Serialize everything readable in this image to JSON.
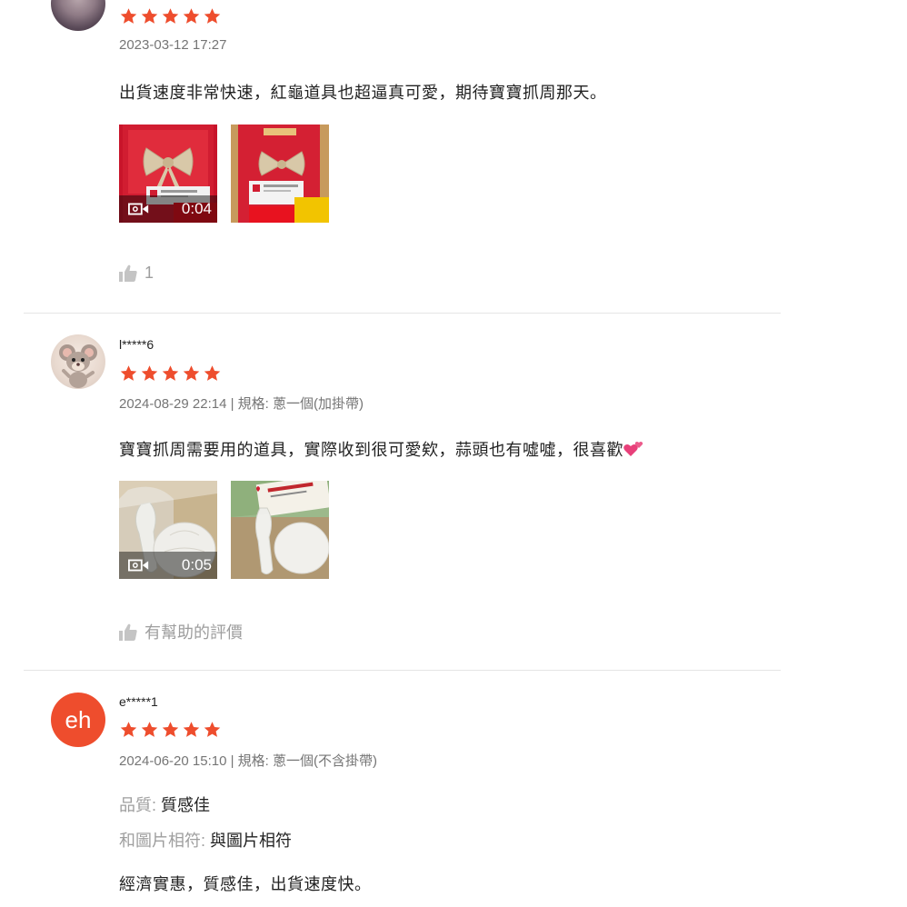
{
  "colors": {
    "star": "#ee4d2d",
    "avatar_initials_bg": "#ee4d2d",
    "meta_text": "#757575",
    "like_text": "#9e9e9e"
  },
  "reviews": [
    {
      "username": "",
      "rating": 5,
      "meta": "2023-03-12 17:27",
      "comment": "出貨速度非常快速，紅龜道具也超逼真可愛，期待寶寶抓周那天。",
      "media": [
        {
          "type": "video",
          "duration": "0:04",
          "icon": "video-camera-icon"
        },
        {
          "type": "image",
          "icon": "photo"
        }
      ],
      "like_label": "1"
    },
    {
      "username": "l*****6",
      "rating": 5,
      "meta": "2024-08-29 22:14 | 規格: 蔥一個(加掛帶)",
      "comment": "寶寶抓周需要用的道具，實際收到很可愛欸，蒜頭也有噓噓，很喜歡",
      "comment_emoji": "two-hearts-icon",
      "media": [
        {
          "type": "video",
          "duration": "0:05",
          "icon": "video-camera-icon"
        },
        {
          "type": "image",
          "icon": "photo"
        }
      ],
      "like_label": "有幫助的評價"
    },
    {
      "username": "e*****1",
      "avatar_initials": "eh",
      "rating": 5,
      "meta": "2024-06-20 15:10 | 規格: 蔥一個(不含掛帶)",
      "attributes": [
        {
          "label": "品質:",
          "value": "質感佳"
        },
        {
          "label": "和圖片相符:",
          "value": "與圖片相符"
        }
      ],
      "comment": "經濟實惠，質感佳，出貨速度快。"
    }
  ]
}
